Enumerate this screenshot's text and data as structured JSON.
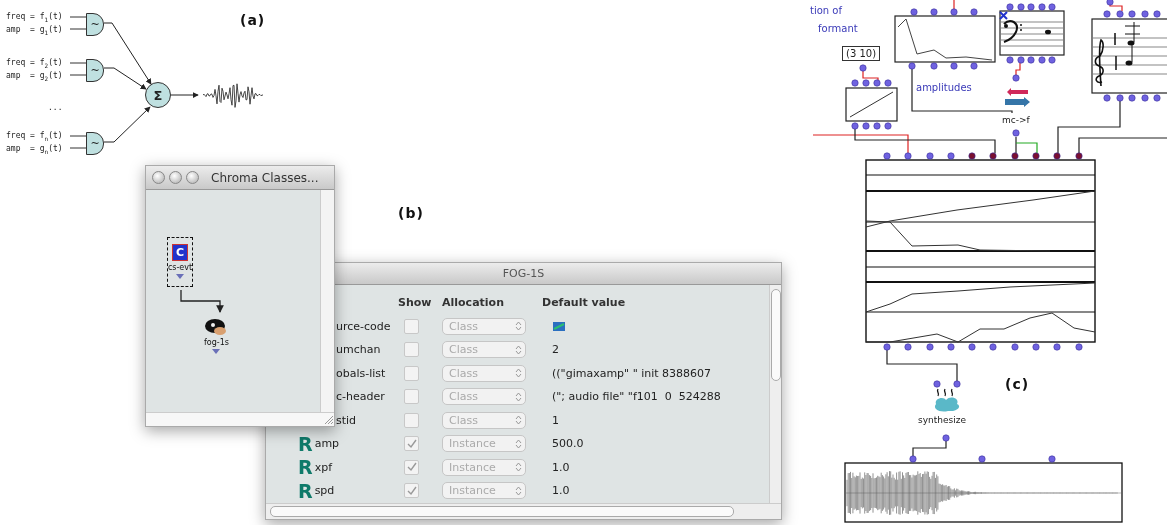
{
  "panel_a": {
    "label": "(a)",
    "oscillators": [
      {
        "freq": "freq = f$_{1}$(t)",
        "amp": "amp  = g$_{1}$(t)",
        "symbol": "~"
      },
      {
        "freq": "freq = f$_{2}$(t)",
        "amp": "amp  = g$_{2}$(t)",
        "symbol": "~"
      },
      {
        "freq": "freq = f$_{n}$(t)",
        "amp": "amp  = g$_{n}$(t)",
        "symbol": "~"
      }
    ],
    "ellipsis": "...",
    "sum_symbol": "Σ"
  },
  "panel_b": {
    "label": "(b)",
    "patch_window": {
      "title": "Chroma Classes...",
      "boxes": [
        {
          "kind": "class",
          "badge": "C",
          "name": "cs-evt",
          "selected": true
        },
        {
          "kind": "sound",
          "name": "fog-1s",
          "selected": false
        }
      ]
    },
    "class_editor": {
      "title": "FOG-1S",
      "columns": [
        "Show",
        "Allocation",
        "Default value"
      ],
      "slots": [
        {
          "kind": "class",
          "name": "urce-code",
          "checked": false,
          "allocation": "Class",
          "default": {
            "kind": "icon"
          }
        },
        {
          "kind": "class",
          "name": "umchan",
          "checked": false,
          "allocation": "Class",
          "default": "2"
        },
        {
          "kind": "class",
          "name": "obals-list",
          "checked": false,
          "allocation": "Class",
          "default": "((\"gimaxamp\" \" init 8388607"
        },
        {
          "kind": "class",
          "name": "c-header",
          "checked": false,
          "allocation": "Class",
          "default": "(\"; audio file\" \"f101  0  524288"
        },
        {
          "kind": "class",
          "name": "stid",
          "checked": false,
          "allocation": "Class",
          "default": "1"
        },
        {
          "kind": "instance",
          "badge": "R",
          "name": "amp",
          "checked": true,
          "allocation": "Instance",
          "default": "500.0"
        },
        {
          "kind": "instance",
          "badge": "R",
          "name": "xpf",
          "checked": true,
          "allocation": "Instance",
          "default": "1.0"
        },
        {
          "kind": "instance",
          "badge": "R",
          "name": "spd",
          "checked": true,
          "allocation": "Instance",
          "default": "1.0"
        }
      ]
    }
  },
  "panel_c": {
    "label": "(c)",
    "comment": [
      "tion of",
      "formant"
    ],
    "list_box": "(3 10)",
    "bpf_label": "amplitudes",
    "converter_label": "mc->f",
    "synth_label": "synthesize"
  }
}
